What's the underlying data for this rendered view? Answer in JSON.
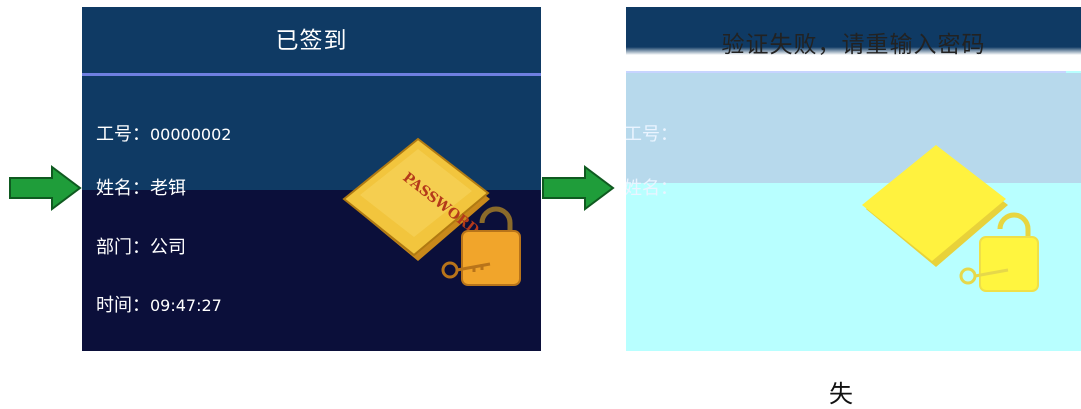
{
  "success_screen": {
    "title": "已签到",
    "fields": [
      {
        "label": "工号：",
        "value": "00000002"
      },
      {
        "label": "姓名：",
        "value": "老铒"
      },
      {
        "label": "部门：",
        "value": "公司"
      },
      {
        "label": "时间：",
        "value": "09:47:27"
      }
    ],
    "badge_text": "PASSWORD"
  },
  "fail_screen": {
    "title": "验证失败，请重输入密码",
    "fields": [
      {
        "label": "工号："
      },
      {
        "label": "姓名："
      }
    ]
  },
  "caption": "失",
  "icons": [
    "green-arrow-icon",
    "password-book-lock-icon"
  ],
  "colors": {
    "arrow_green": "#1f9d3a",
    "header_blue": "#0f3a64",
    "screen_dark": "#0b0f3a",
    "fail_bg": "#b8ffff",
    "book_gold": "#f2c53d",
    "lock_orange": "#f1a52b"
  }
}
